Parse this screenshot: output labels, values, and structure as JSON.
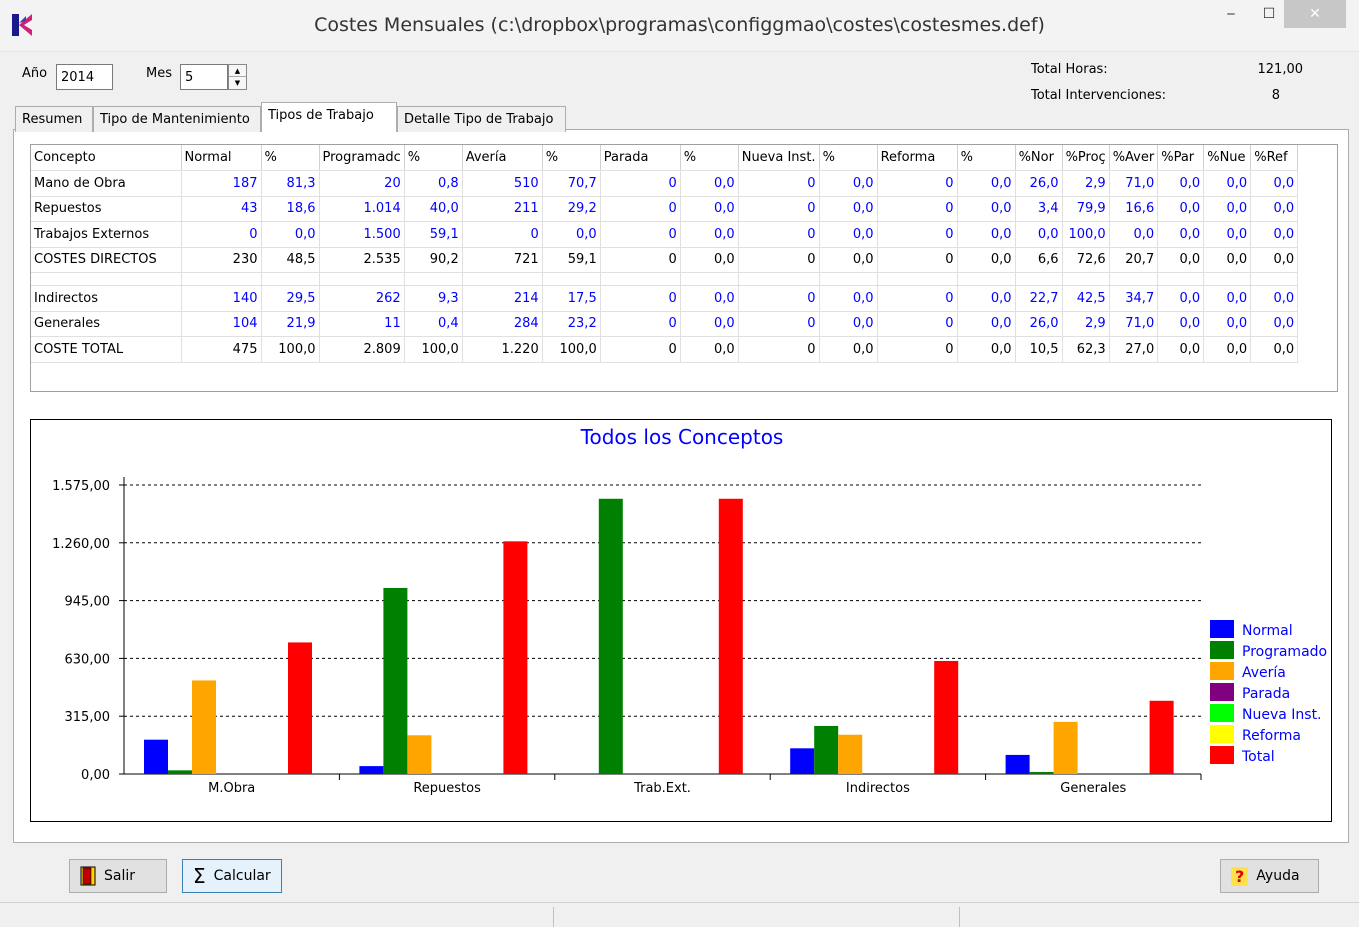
{
  "window": {
    "title": "Costes Mensuales (c:\\dropbox\\programas\\configgmao\\costes\\costesmes.def)",
    "min_glyph": "‒",
    "max_glyph": "☐",
    "close_glyph": "✕"
  },
  "form": {
    "year_label": "Año",
    "year_value": "2014",
    "month_label": "Mes",
    "month_value": "5",
    "total_hours_label": "Total Horas:",
    "total_hours_value": "121,00",
    "total_interventions_label": "Total Intervenciones:",
    "total_interventions_value": "8"
  },
  "tabs": [
    {
      "label": "Resumen"
    },
    {
      "label": "Tipo de Mantenimiento"
    },
    {
      "label": "Tipos de Trabajo"
    },
    {
      "label": "Detalle Tipo de Trabajo"
    }
  ],
  "grid": {
    "headers": [
      "Concepto",
      "Normal",
      "%",
      "Programadc",
      "%",
      "Avería",
      "%",
      "Parada",
      "%",
      "Nueva Inst.",
      "%",
      "Reforma",
      "%",
      "%Nor",
      "%Proç",
      "%Aver",
      "%Par",
      "%Nue",
      "%Ref"
    ],
    "rows": [
      {
        "cells": [
          "Mano de Obra",
          "187",
          "81,3",
          "20",
          "0,8",
          "510",
          "70,7",
          "0",
          "0,0",
          "0",
          "0,0",
          "0",
          "0,0",
          "26,0",
          "2,9",
          "71,0",
          "0,0",
          "0,0",
          "0,0"
        ],
        "type": "blue"
      },
      {
        "cells": [
          "Repuestos",
          "43",
          "18,6",
          "1.014",
          "40,0",
          "211",
          "29,2",
          "0",
          "0,0",
          "0",
          "0,0",
          "0",
          "0,0",
          "3,4",
          "79,9",
          "16,6",
          "0,0",
          "0,0",
          "0,0"
        ],
        "type": "blue"
      },
      {
        "cells": [
          "Trabajos Externos",
          "0",
          "0,0",
          "1.500",
          "59,1",
          "0",
          "0,0",
          "0",
          "0,0",
          "0",
          "0,0",
          "0",
          "0,0",
          "0,0",
          "100,0",
          "0,0",
          "0,0",
          "0,0",
          "0,0"
        ],
        "type": "blue"
      },
      {
        "cells": [
          "COSTES DIRECTOS",
          "230",
          "48,5",
          "2.535",
          "90,2",
          "721",
          "59,1",
          "0",
          "0,0",
          "0",
          "0,0",
          "0",
          "0,0",
          "6,6",
          "72,6",
          "20,7",
          "0,0",
          "0,0",
          "0,0"
        ],
        "type": "total"
      },
      {
        "cells": [
          "Indirectos",
          "140",
          "29,5",
          "262",
          "9,3",
          "214",
          "17,5",
          "0",
          "0,0",
          "0",
          "0,0",
          "0",
          "0,0",
          "22,7",
          "42,5",
          "34,7",
          "0,0",
          "0,0",
          "0,0"
        ],
        "type": "blue"
      },
      {
        "cells": [
          "Generales",
          "104",
          "21,9",
          "11",
          "0,4",
          "284",
          "23,2",
          "0",
          "0,0",
          "0",
          "0,0",
          "0",
          "0,0",
          "26,0",
          "2,9",
          "71,0",
          "0,0",
          "0,0",
          "0,0"
        ],
        "type": "blue"
      },
      {
        "cells": [
          "COSTE TOTAL",
          "475",
          "100,0",
          "2.809",
          "100,0",
          "1.220",
          "100,0",
          "0",
          "0,0",
          "0",
          "0,0",
          "0",
          "0,0",
          "10,5",
          "62,3",
          "27,0",
          "0,0",
          "0,0",
          "0,0"
        ],
        "type": "total"
      }
    ]
  },
  "chart_data": {
    "type": "bar",
    "title": "Todos los Conceptos",
    "categories": [
      "M.Obra",
      "Repuestos",
      "Trab.Ext.",
      "Indirectos",
      "Generales"
    ],
    "ylim": [
      0,
      1575
    ],
    "yticks": [
      "0,00",
      "315,00",
      "630,00",
      "945,00",
      "1.260,00",
      "1.575,00"
    ],
    "ytick_values": [
      0,
      315,
      630,
      945,
      1260,
      1575
    ],
    "grid": true,
    "legend_position": "right",
    "series": [
      {
        "name": "Normal",
        "color": "#0000ff",
        "values": [
          187,
          43,
          0,
          140,
          104
        ]
      },
      {
        "name": "Programado",
        "color": "#008000",
        "values": [
          20,
          1014,
          1500,
          262,
          11
        ]
      },
      {
        "name": "Avería",
        "color": "#ffa500",
        "values": [
          510,
          211,
          0,
          214,
          284
        ]
      },
      {
        "name": "Parada",
        "color": "#800080",
        "values": [
          0,
          0,
          0,
          0,
          0
        ]
      },
      {
        "name": "Nueva Inst.",
        "color": "#00ff00",
        "values": [
          0,
          0,
          0,
          0,
          0
        ]
      },
      {
        "name": "Reforma",
        "color": "#ffff00",
        "values": [
          0,
          0,
          0,
          0,
          0
        ]
      },
      {
        "name": "Total",
        "color": "#ff0000",
        "values": [
          717,
          1268,
          1500,
          616,
          399
        ]
      }
    ]
  },
  "buttons": {
    "exit_label": "Salir",
    "calc_label": "Calcular",
    "help_label": "Ayuda",
    "calc_glyph": "Σ",
    "help_glyph": "?"
  }
}
